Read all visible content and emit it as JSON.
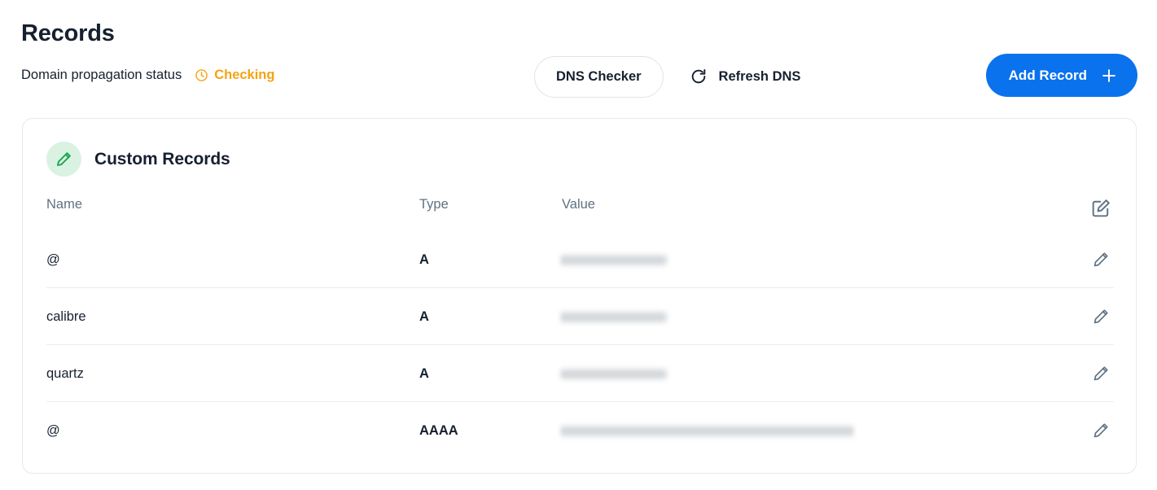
{
  "header": {
    "title": "Records",
    "status_label": "Domain propagation status",
    "status_value": "Checking",
    "status_color": "#f5a313",
    "status_icon": "clock-icon",
    "dns_checker_label": "DNS Checker",
    "refresh_label": "Refresh DNS",
    "refresh_icon": "refresh-icon",
    "add_record_label": "Add Record",
    "add_record_icon": "plus-icon",
    "accent_color": "#0a72ed"
  },
  "card": {
    "title": "Custom Records",
    "badge_icon": "pencil-icon",
    "badge_color": "#16a34a",
    "badge_bg": "#d9f2e1",
    "header_edit_icon": "edit-square-icon",
    "columns": {
      "name": "Name",
      "type": "Type",
      "value": "Value"
    },
    "rows": [
      {
        "name": "@",
        "type": "A",
        "value": "",
        "value_redacted": true,
        "value_width": 128,
        "action_icon": "pencil-icon"
      },
      {
        "name": "calibre",
        "type": "A",
        "value": "",
        "value_redacted": true,
        "value_width": 128,
        "action_icon": "pencil-icon"
      },
      {
        "name": "quartz",
        "type": "A",
        "value": "",
        "value_redacted": true,
        "value_width": 128,
        "action_icon": "pencil-icon"
      },
      {
        "name": "@",
        "type": "AAAA",
        "value": "",
        "value_redacted": true,
        "value_width": 360,
        "action_icon": "pencil-icon"
      }
    ]
  }
}
